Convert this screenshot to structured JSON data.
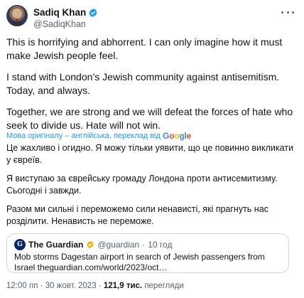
{
  "author": {
    "name": "Sadiq Khan",
    "handle": "@SadiqKhan",
    "verified_color": "#1d9bf0"
  },
  "tweet": {
    "paragraphs": [
      "This is horrifying and abhorrent. I can only imagine how it must make Jewish people feel.",
      "I stand with London’s Jewish community against antisemitism. Today, and always.",
      "Together, we are strong and we will defeat the forces of hate who seek to divide us. Hate will not win."
    ]
  },
  "translation": {
    "label": "Мова оригіналу – англійська, переклад від",
    "provider": "Google",
    "paragraphs": [
      "Це жахливо і огидно. Я можу тільки уявити, що це повинно викликати у євреїв.",
      "Я виступаю за єврейську громаду Лондона проти антисемитизму. Сьогодні і завжди.",
      "Разом ми сильні і переможемо сили ненависті, які прагнуть нас розділити. Ненависть не переможе."
    ]
  },
  "quote": {
    "source_name": "The Guardian",
    "handle": "@guardian",
    "separator": "·",
    "age": "10 год",
    "text": "Mob storms Dagestan airport in search of Jewish passengers from Israel theguardian.com/world/2023/oct…"
  },
  "meta": {
    "time": "12:00 пп",
    "separator": "·",
    "date": "30 жовт. 2023",
    "views_count": "121,9 тис.",
    "views_label": "перегляди"
  },
  "colors": {
    "link": "#1d9bf0",
    "secondary_text": "#536471",
    "border": "#cfd9de"
  }
}
